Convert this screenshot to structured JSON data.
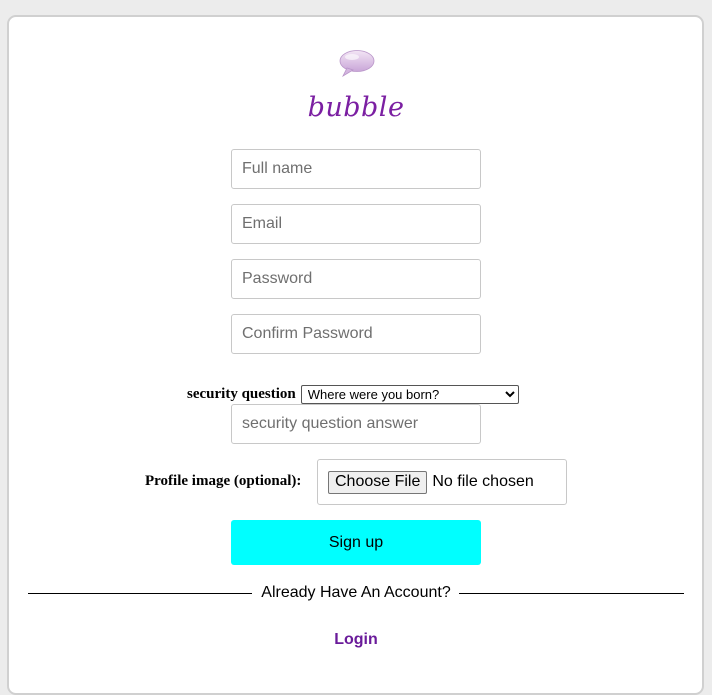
{
  "brand": {
    "name": "bubble",
    "icon": "speech-bubble-icon",
    "color": "#7b1fa2"
  },
  "form": {
    "full_name": {
      "placeholder": "Full name",
      "value": ""
    },
    "email": {
      "placeholder": "Email",
      "value": ""
    },
    "password": {
      "placeholder": "Password",
      "value": ""
    },
    "confirm_password": {
      "placeholder": "Confirm Password",
      "value": ""
    },
    "security_question": {
      "label": "security question",
      "selected": "Where were you born?"
    },
    "security_answer": {
      "placeholder": "security question answer",
      "value": ""
    },
    "profile_image": {
      "label": "Profile image (optional):",
      "button_label": "Choose File",
      "status": "No file chosen"
    },
    "submit": {
      "label": "Sign up",
      "color": "#00ffff"
    }
  },
  "footer": {
    "divider_text": "Already Have An Account?",
    "login_label": "Login",
    "login_color": "#6a1b9a"
  }
}
